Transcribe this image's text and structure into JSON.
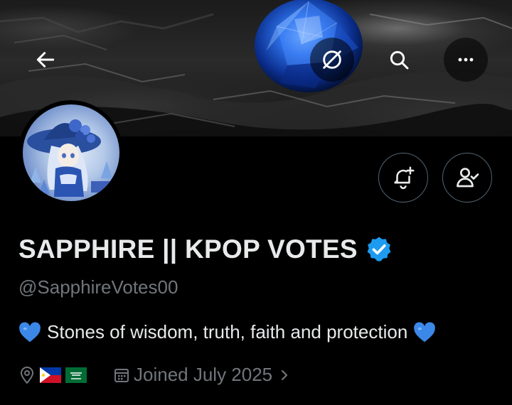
{
  "header": {
    "icons": {
      "back": "arrow-left-icon",
      "nolink": "no-link-icon",
      "search": "search-icon",
      "more": "more-horizontal-icon"
    }
  },
  "profile": {
    "display_name": "SAPPHIRE || KPOP VOTES",
    "handle": "@SapphireVotes00",
    "verified": true,
    "verified_color": "#1d9bf0",
    "bio": "Stones of wisdom, truth, faith and protection",
    "bio_emoji": "blue-heart-icon",
    "location_flags": [
      "philippines-flag-icon",
      "saudi-arabia-flag-icon"
    ],
    "joined": "Joined July 2025"
  },
  "actions": {
    "notify_icon": "bell-plus-icon",
    "follow_icon": "person-check-icon"
  },
  "colors": {
    "background": "#000000",
    "text_primary": "#e7e9ea",
    "text_secondary": "#71767b",
    "border": "#536471",
    "accent": "#1d9bf0"
  }
}
